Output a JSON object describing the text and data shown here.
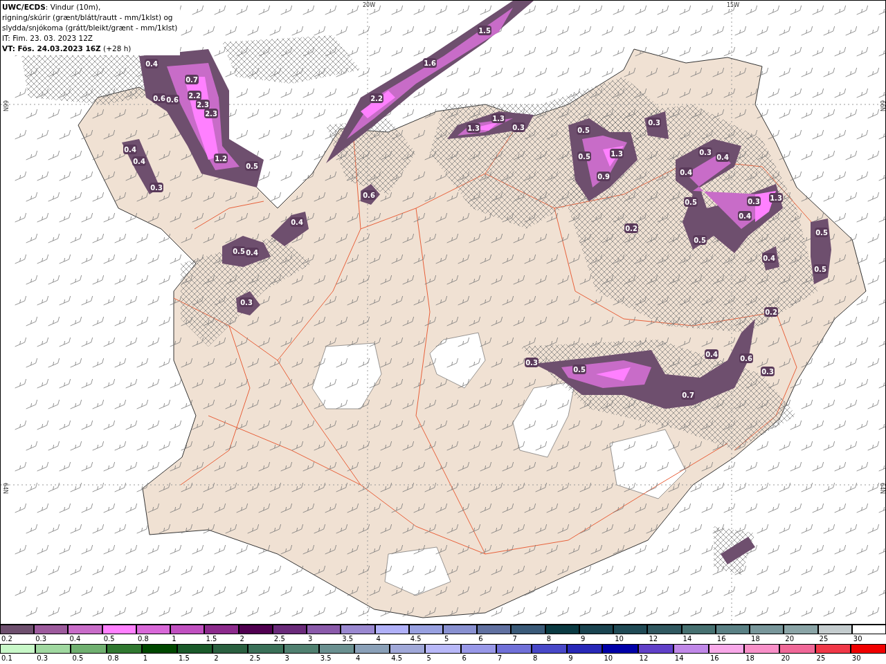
{
  "header": {
    "lines": [
      "**UWC/ECDS**: Vindur (10m),",
      "rigning/skúrir (grænt/blátt/rautt - mm/1klst) og",
      "slydda/snjókoma (grátt/bleikt/grænt - mm/1klst)",
      "IT: Fim. 23. 03. 2023 12Z",
      "**VT: Fös. 24.03.2023 16Z** (+28 h)"
    ]
  },
  "map": {
    "grid_labels": [
      {
        "text": "20W",
        "kind": "lon"
      },
      {
        "text": "15W",
        "kind": "lon"
      },
      {
        "text": "66N",
        "kind": "lat"
      },
      {
        "text": "66N",
        "kind": "lat"
      },
      {
        "text": "64N",
        "kind": "lat"
      },
      {
        "text": "64N",
        "kind": "lat"
      }
    ],
    "precipitation_values": [
      "0.4",
      "0.7",
      "2.2",
      "0.6",
      "0.6",
      "2.3",
      "2.3",
      "1.2",
      "0.5",
      "0.4",
      "0.4",
      "0.3",
      "1.5",
      "1.6",
      "2.2",
      "1.3",
      "1.3",
      "0.3",
      "0.5",
      "0.3",
      "1.3",
      "0.5",
      "0.9",
      "0.3",
      "0.4",
      "0.4",
      "0.6",
      "0.5",
      "0.3",
      "1.3",
      "0.4",
      "0.4",
      "0.2",
      "0.5",
      "0.5",
      "0.5",
      "0.4",
      "0.4",
      "0.5",
      "0.3",
      "0.2",
      "0.4",
      "0.6",
      "0.3",
      "0.5",
      "0.3",
      "0.7"
    ]
  },
  "legend_top": [
    {
      "label": "0.2",
      "color": "#6e4f6e"
    },
    {
      "label": "0.3",
      "color": "#9c5a9c"
    },
    {
      "label": "0.4",
      "color": "#c86cc8"
    },
    {
      "label": "0.5",
      "color": "#ff80ff"
    },
    {
      "label": "0.8",
      "color": "#d868d8"
    },
    {
      "label": "1",
      "color": "#c050c0"
    },
    {
      "label": "1.5",
      "color": "#8c2a8c"
    },
    {
      "label": "2",
      "color": "#500050"
    },
    {
      "label": "2.5",
      "color": "#6a2a7a"
    },
    {
      "label": "3",
      "color": "#8a5aaa"
    },
    {
      "label": "3.5",
      "color": "#9a88d0"
    },
    {
      "label": "4",
      "color": "#b0b0f8"
    },
    {
      "label": "4.5",
      "color": "#98a0e0"
    },
    {
      "label": "5",
      "color": "#8890d0"
    },
    {
      "label": "6",
      "color": "#6070a0"
    },
    {
      "label": "7",
      "color": "#3a5a78"
    },
    {
      "label": "8",
      "color": "#0a3a42"
    },
    {
      "label": "9",
      "color": "#1a4450"
    },
    {
      "label": "10",
      "color": "#204a55"
    },
    {
      "label": "12",
      "color": "#305860"
    },
    {
      "label": "14",
      "color": "#467070"
    },
    {
      "label": "16",
      "color": "#5a8084"
    },
    {
      "label": "18",
      "color": "#78969a"
    },
    {
      "label": "20",
      "color": "#8aa4a6"
    },
    {
      "label": "25",
      "color": "#c4ccce"
    },
    {
      "label": "30",
      "color": "#ffffff"
    }
  ],
  "legend_bottom": [
    {
      "label": "0.1",
      "color": "#c8f8c8"
    },
    {
      "label": "0.3",
      "color": "#a0d8a0"
    },
    {
      "label": "0.5",
      "color": "#70b070"
    },
    {
      "label": "0.8",
      "color": "#307830"
    },
    {
      "label": "1",
      "color": "#004800"
    },
    {
      "label": "1.5",
      "color": "#1a5a2a"
    },
    {
      "label": "2",
      "color": "#2a6040"
    },
    {
      "label": "2.5",
      "color": "#3a7058"
    },
    {
      "label": "3",
      "color": "#508070"
    },
    {
      "label": "3.5",
      "color": "#6a9090"
    },
    {
      "label": "4",
      "color": "#8aa0b8"
    },
    {
      "label": "4.5",
      "color": "#a0a8d8"
    },
    {
      "label": "5",
      "color": "#b8b8f8"
    },
    {
      "label": "6",
      "color": "#9898e8"
    },
    {
      "label": "7",
      "color": "#7070d8"
    },
    {
      "label": "8",
      "color": "#4848c8"
    },
    {
      "label": "9",
      "color": "#2828b8"
    },
    {
      "label": "10",
      "color": "#0000a8"
    },
    {
      "label": "12",
      "color": "#6040c8"
    },
    {
      "label": "14",
      "color": "#c088e8"
    },
    {
      "label": "16",
      "color": "#f8a8e8"
    },
    {
      "label": "18",
      "color": "#f890c8"
    },
    {
      "label": "20",
      "color": "#f06898"
    },
    {
      "label": "25",
      "color": "#f03848"
    },
    {
      "label": "30",
      "color": "#f00000"
    }
  ]
}
